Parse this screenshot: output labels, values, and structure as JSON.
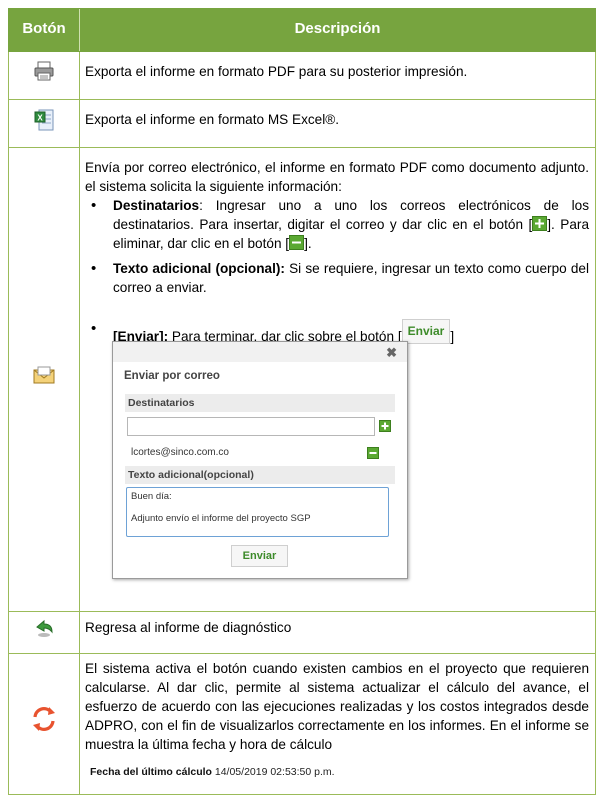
{
  "header": {
    "col_button": "Botón",
    "col_description": "Descripción"
  },
  "rows": [
    {
      "icon": "printer-icon",
      "description": "Exporta el informe en formato PDF para su posterior impresión."
    },
    {
      "icon": "excel-icon",
      "description": "Exporta el informe en formato MS Excel®."
    },
    {
      "icon": "email-icon",
      "intro": "Envía por correo electrónico, el informe en formato PDF como documento adjunto. el sistema solicita la siguiente información:",
      "bullet1_bold": "Destinatarios",
      "bullet1_text": ": Ingresar uno a uno los correos electrónicos de los destinatarios. Para insertar, digitar el correo y dar clic en el botón [",
      "bullet1_mid": "]. Para eliminar, dar clic en el botón [",
      "bullet1_end": "].",
      "bullet2_bold": "Texto adicional (opcional):",
      "bullet2_text": " Si se requiere, ingresar un texto como cuerpo del correo a enviar.",
      "bullet3_bold": "[Enviar]:",
      "bullet3_text": " Para terminar, dar clic sobre el botón [",
      "bullet3_btn": "Enviar",
      "bullet3_end": "]",
      "dialog": {
        "title": "Enviar por correo",
        "recipients_label": "Destinatarios",
        "recipient_email": "lcortes@sinco.com.co",
        "extra_label": "Texto adicional(opcional)",
        "message_line1": "Buen día:",
        "message_line2": "Adjunto envío el informe del proyecto SGP",
        "send_label": "Enviar"
      }
    },
    {
      "icon": "back-arrow-icon",
      "description": "Regresa al informe de diagnóstico"
    },
    {
      "icon": "refresh-icon",
      "description": "El sistema activa el botón cuando existen cambios en el proyecto que requieren calcularse. Al dar clic, permite al sistema actualizar el cálculo del avance, el esfuerzo de acuerdo con las ejecuciones realizadas y los costos integrados desde ADPRO, con el fin de visualizarlos correctamente en los informes. En el informe se muestra la última fecha y hora de cálculo",
      "last_calc_label": "Fecha del último cálculo",
      "last_calc_value": "14/05/2019 02:53:50 p.m."
    }
  ]
}
